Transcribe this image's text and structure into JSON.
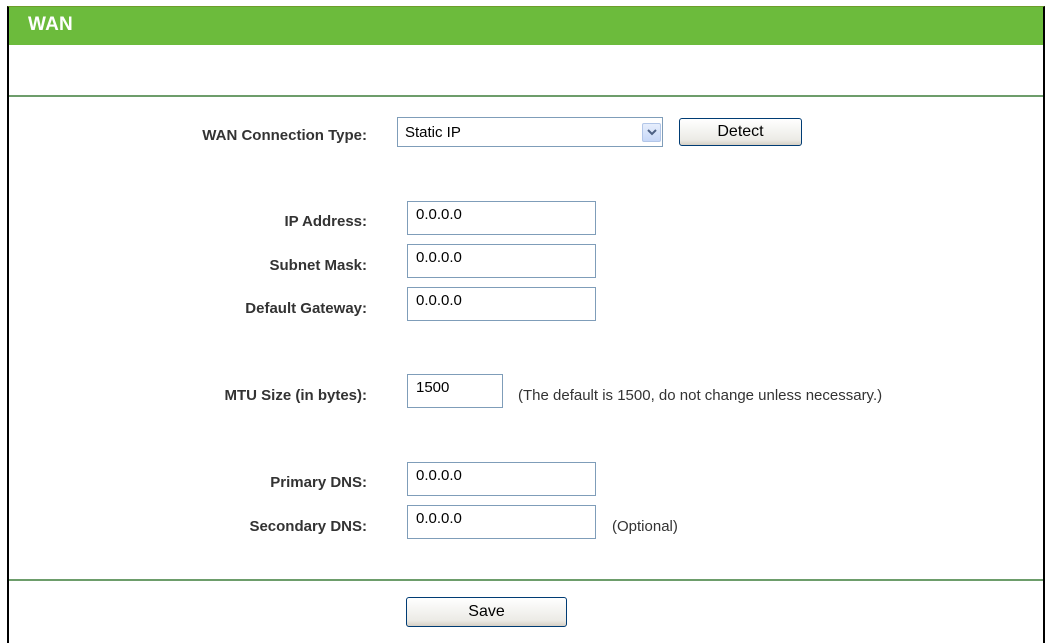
{
  "header": {
    "title": "WAN"
  },
  "form": {
    "connection_type": {
      "label": "WAN Connection Type:",
      "selected": "Static IP",
      "detect_label": "Detect"
    },
    "ip_address": {
      "label": "IP Address:",
      "value": "0.0.0.0"
    },
    "subnet_mask": {
      "label": "Subnet Mask:",
      "value": "0.0.0.0"
    },
    "default_gateway": {
      "label": "Default Gateway:",
      "value": "0.0.0.0"
    },
    "mtu": {
      "label": "MTU Size (in bytes):",
      "value": "1500",
      "note": "(The default is 1500, do not change unless necessary.)"
    },
    "primary_dns": {
      "label": "Primary DNS:",
      "value": "0.0.0.0"
    },
    "secondary_dns": {
      "label": "Secondary DNS:",
      "value": "0.0.0.0",
      "note": "(Optional)"
    },
    "save_label": "Save"
  },
  "colors": {
    "header_green": "#6cbb3c",
    "divider_green": "#6d9d6b",
    "label_text": "#333333",
    "input_border": "#7f9db9",
    "button_border": "#003c74"
  },
  "icons": {
    "select_arrow": "chevron-down-icon"
  }
}
